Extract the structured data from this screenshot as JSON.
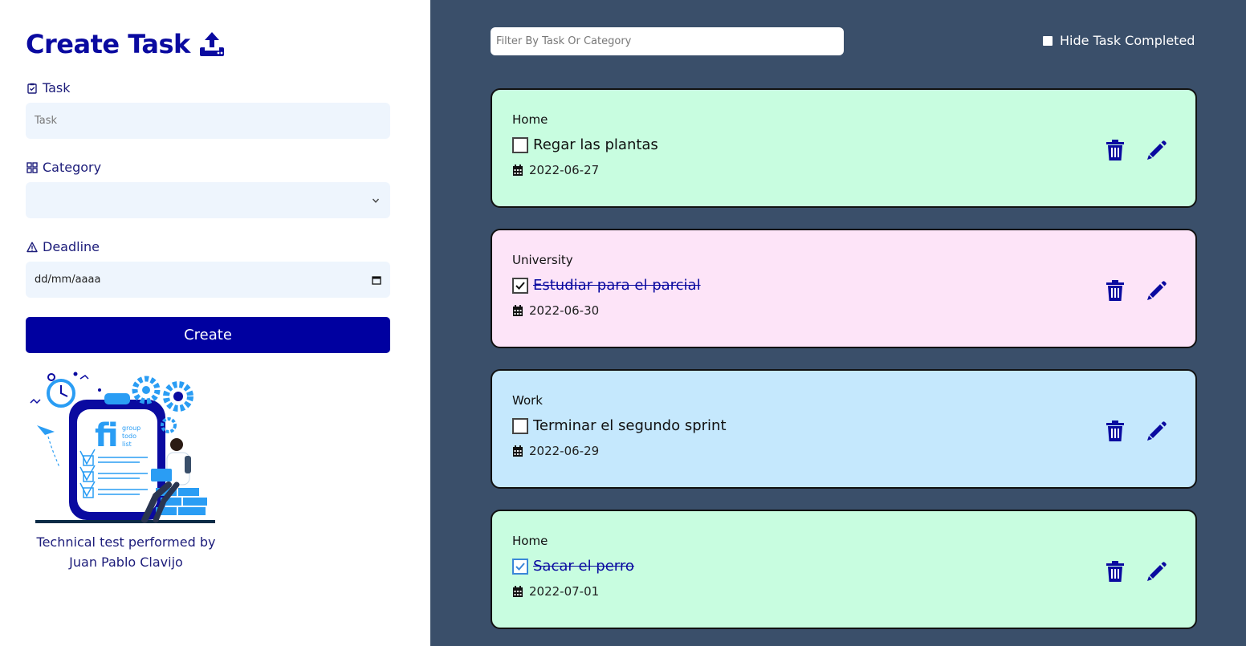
{
  "form": {
    "title": "Create Task",
    "task_label": "Task",
    "task_placeholder": "Task",
    "category_label": "Category",
    "category_value": "",
    "deadline_label": "Deadline",
    "deadline_placeholder": "dd/mm/aaaa",
    "create_button": "Create"
  },
  "illustration": {
    "logo_text": "fi",
    "logo_caption": [
      "group",
      "todo",
      "list"
    ]
  },
  "credit": {
    "line1": "Technical test performed by",
    "line2": "Juan Pablo Clavijo"
  },
  "filter": {
    "placeholder": "Filter By Task Or Category"
  },
  "hide_completed": {
    "label": "Hide Task Completed",
    "checked": false
  },
  "tasks": [
    {
      "category": "Home",
      "name": "Regar las plantas",
      "date": "2022-06-27",
      "completed": false,
      "color": "#c8fde0"
    },
    {
      "category": "University",
      "name": "Estudiar para el parcial",
      "date": "2022-06-30",
      "completed": true,
      "color": "#fde4f8"
    },
    {
      "category": "Work",
      "name": "Terminar el segundo sprint",
      "date": "2022-06-29",
      "completed": false,
      "color": "#c5e8fd"
    },
    {
      "category": "Home",
      "name": "Sacar el perro",
      "date": "2022-07-01",
      "completed": true,
      "color": "#c8fde0"
    }
  ],
  "colors": {
    "accent": "#0000a0",
    "right_bg": "#3a4f6a",
    "input_bg": "#eef5fd"
  },
  "icons": {
    "title": "upload-icon",
    "task_label": "clipboard-check-icon",
    "category_label": "grid-icon",
    "deadline_label": "warning-triangle-icon",
    "date": "calendar-icon",
    "delete": "trash-icon",
    "edit": "pencil-icon"
  }
}
